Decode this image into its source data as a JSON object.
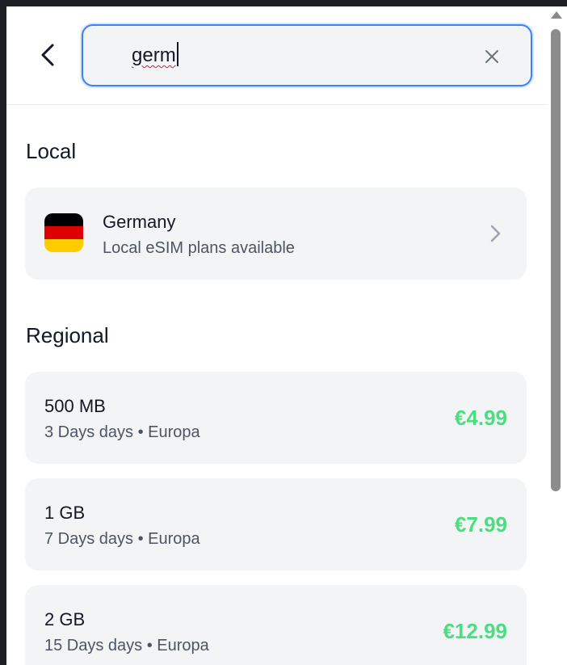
{
  "search": {
    "value": "germ",
    "clear_icon": "close-icon",
    "back_icon": "chevron-left-icon"
  },
  "sections": {
    "local_title": "Local",
    "regional_title": "Regional"
  },
  "local_results": [
    {
      "name": "Germany",
      "subtitle": "Local eSIM plans available",
      "flag_colors": [
        "#000000",
        "#dd0000",
        "#ffcc00"
      ],
      "icon": "chevron-right-icon"
    }
  ],
  "regional_results": [
    {
      "data": "500 MB",
      "details": "3 Days days • Europa",
      "price": "€4.99"
    },
    {
      "data": "1 GB",
      "details": "7 Days days • Europa",
      "price": "€7.99"
    },
    {
      "data": "2 GB",
      "details": "15 Days days • Europa",
      "price": "€12.99"
    }
  ],
  "colors": {
    "accent": "#3b82f6",
    "price": "#4ade80",
    "card_bg": "#f3f4f6"
  }
}
